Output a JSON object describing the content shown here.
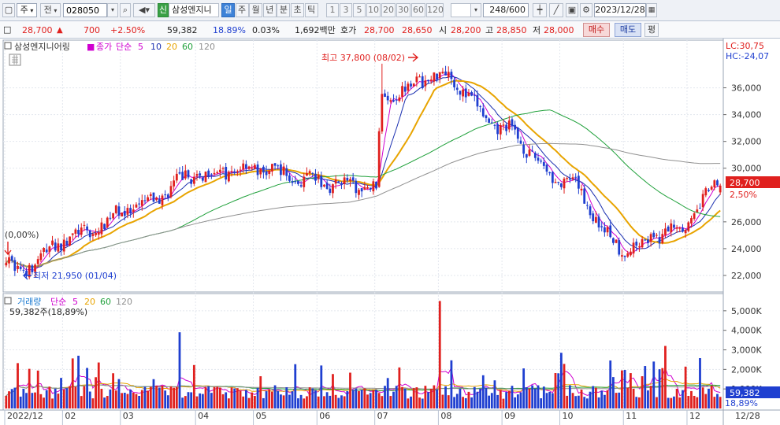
{
  "toolbar": {
    "market_label": "주",
    "prefix_label": "전",
    "code": "028050",
    "credit_badge": "신",
    "stock_name": "삼성엔지니",
    "periods": [
      "일",
      "주",
      "월",
      "년",
      "분",
      "초",
      "틱"
    ],
    "active_period": "일",
    "minute_options": [
      "1",
      "3",
      "5",
      "10",
      "20",
      "30",
      "60",
      "120"
    ],
    "count": "248/600",
    "date": "2023/12/28"
  },
  "info": {
    "price": "28,700",
    "change": "700",
    "change_pct": "+2.50%",
    "volume": "59,382",
    "volume_ratio": "18.89%",
    "turnover": "0.03%",
    "amount": "1,692백만",
    "hoga_label": "호가",
    "ask": "28,700",
    "bid": "28,650",
    "open_label": "시",
    "open": "28,200",
    "high_label": "고",
    "high": "28,850",
    "low_label": "저",
    "low": "28,000",
    "buy_label": "매수",
    "sell_label": "매도",
    "even_label": "평"
  },
  "legend": {
    "name": "삼성엔지니어링",
    "price_label": "종가",
    "ma_label": "단순",
    "ma_periods": [
      "5",
      "10",
      "20",
      "60",
      "120"
    ],
    "volume_label": "거래량",
    "volume_value": "59,382주(18,89%)"
  },
  "right_axis": {
    "lc": "LC:30,75",
    "hc": "HC:-24,07",
    "price_ticks": [
      "36,000",
      "34,000",
      "32,000",
      "30,000",
      "26,000",
      "24,000",
      "22,000"
    ],
    "current_price": "28,700",
    "current_pct": "2,50%",
    "volume_ticks": [
      "5,000K",
      "4,000K",
      "3,000K",
      "2,000K",
      "1,000K"
    ],
    "current_volume": "59,382",
    "current_vol_pct": "18,89%"
  },
  "annotations": {
    "high_label": "최고 37,800 (08/02)",
    "low_label": "최저 21,950 (01/04)",
    "start_pct": "(0,00%)"
  },
  "x_labels": [
    "2022/12",
    "02",
    "03",
    "04",
    "05",
    "06",
    "07",
    "08",
    "09",
    "10",
    "11",
    "12",
    "12/28"
  ],
  "colors": {
    "up": "#e0201e",
    "down": "#1f3fd0",
    "ma5": "#d000d0",
    "ma10": "#1a2fb0",
    "ma20": "#e8a400",
    "ma60": "#1fa03a",
    "ma120": "#909090"
  },
  "chart_data": {
    "type": "candlestick",
    "title": "삼성엔지니어링",
    "period": "daily",
    "y_range": [
      21000,
      38500
    ],
    "volume_range": [
      0,
      5800000
    ],
    "key_points": [
      {
        "date": "2022/12/27",
        "close": 23400
      },
      {
        "date": "2023/01/04",
        "low": 21950
      },
      {
        "date": "2023/01/31",
        "close": 25000
      },
      {
        "date": "2023/02/28",
        "close": 27000
      },
      {
        "date": "2023/03/31",
        "close": 29500
      },
      {
        "date": "2023/04/30",
        "close": 30000
      },
      {
        "date": "2023/05/31",
        "close": 29000
      },
      {
        "date": "2023/06/30",
        "close": 28500
      },
      {
        "date": "2023/07/31",
        "close": 35500
      },
      {
        "date": "2023/08/02",
        "high": 37800
      },
      {
        "date": "2023/08/31",
        "close": 33000
      },
      {
        "date": "2023/09/30",
        "close": 29000
      },
      {
        "date": "2023/10/31",
        "close": 24000
      },
      {
        "date": "2023/11/30",
        "close": 25500
      },
      {
        "date": "2023/12/28",
        "open": 28200,
        "high": 28850,
        "low": 28000,
        "close": 28700,
        "volume": 59382
      }
    ]
  }
}
